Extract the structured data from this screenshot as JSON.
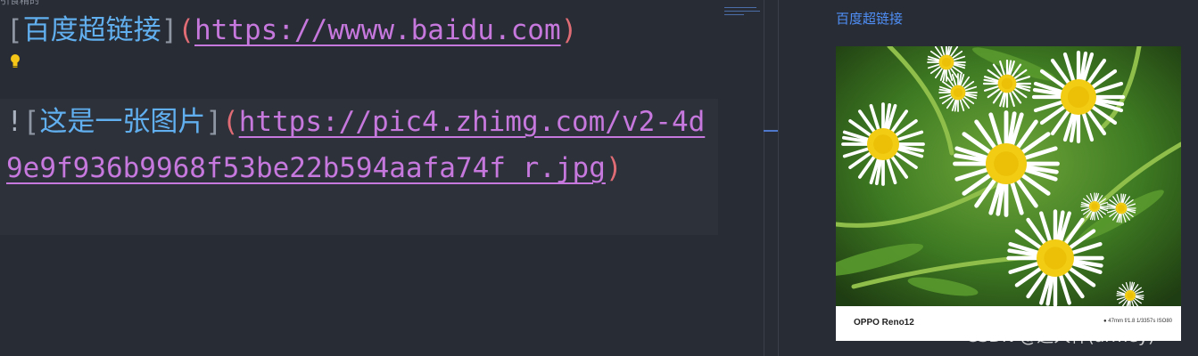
{
  "editor": {
    "cut_text": "引食精的",
    "line1": {
      "open_bracket": "[",
      "link_text": "百度超链接",
      "close_bracket": "]",
      "open_paren": "(",
      "url": "https://wwww.baidu.com",
      "close_paren": ")"
    },
    "line2": {
      "bang": "!",
      "open_bracket": "[",
      "alt_text": "这是一张图片",
      "close_bracket": "]",
      "open_paren": "(",
      "url": "https://pic4.zhimg.com/v2-4d9e9f936b9968f53be22b594aafa74f_r.jpg",
      "close_paren": ")"
    },
    "lightbulb_icon": "lightbulb-icon"
  },
  "preview": {
    "link_text": "百度超链接",
    "image": {
      "description_icon": "daisy-photo",
      "camera_brand": "OPPO Reno12",
      "camera_info": "● 47mm f/1.8 1/3357s ISO80"
    }
  },
  "watermark": "CSDN @道人禅(armey)",
  "colors": {
    "background": "#282c34",
    "link_text": "#61afef",
    "url": "#c678dd",
    "paren": "#e06c75",
    "preview_link": "#4f8ff7"
  }
}
